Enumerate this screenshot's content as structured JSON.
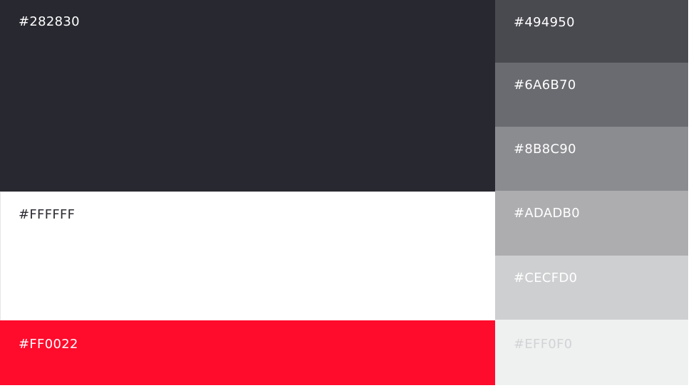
{
  "palette": {
    "left": [
      {
        "label": "#282830",
        "color": "#282830",
        "text_color": "#ffffff"
      },
      {
        "label": "#FFFFFF",
        "color": "#ffffff",
        "text_color": "#2b2b32"
      },
      {
        "label": "#FF0022",
        "color": "#ff0b2c",
        "text_color": "#ffffff"
      }
    ],
    "right": [
      {
        "label": "#494950",
        "color": "#494950",
        "text_color": "#ffffff"
      },
      {
        "label": "#6A6B70",
        "color": "#6a6b70",
        "text_color": "#ffffff"
      },
      {
        "label": "#8B8C90",
        "color": "#8b8c90",
        "text_color": "#ffffff"
      },
      {
        "label": "#ADADB0",
        "color": "#adadb0",
        "text_color": "#ffffff"
      },
      {
        "label": "#CECFD0",
        "color": "#cecfd0",
        "text_color": "#ffffff"
      },
      {
        "label": "#EFF0F0",
        "color": "#eff0f0",
        "text_color": "#d2d3d5"
      }
    ]
  }
}
